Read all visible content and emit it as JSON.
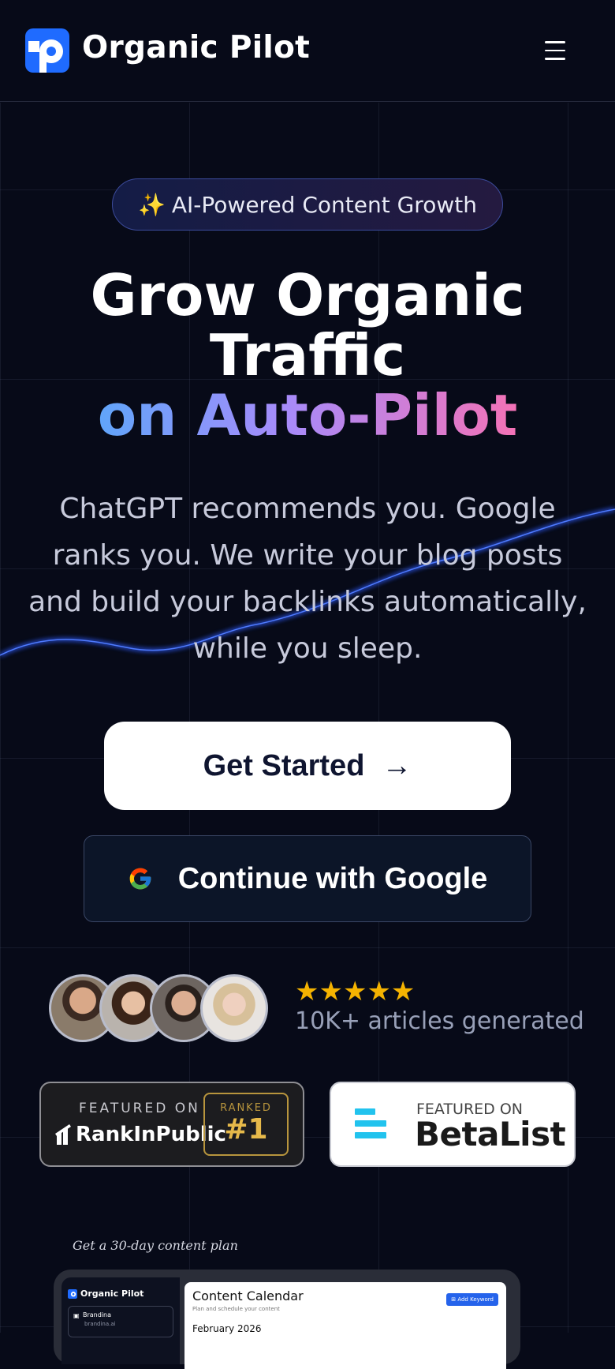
{
  "header": {
    "brand": "Organic Pilot",
    "logo_icon": "organic-pilot-logo",
    "menu_icon": "hamburger-menu-icon"
  },
  "hero": {
    "badge_emoji": "✨",
    "badge_text": "AI-Powered Content Growth",
    "title_line1": "Grow Organic",
    "title_line2": "Traffic",
    "title_line3": "on Auto-Pilot",
    "subtitle": "ChatGPT recommends you. Google ranks you. We write your blog posts and build your backlinks automatically, while you sleep."
  },
  "cta": {
    "primary_label": "Get Started",
    "primary_arrow": "→",
    "google_label": "Continue with Google"
  },
  "social_proof": {
    "avatars": [
      "avatar-1",
      "avatar-2",
      "avatar-3",
      "avatar-4"
    ],
    "stars": "★★★★★",
    "rating": 5,
    "articles_text": "10K+ articles generated"
  },
  "featured": {
    "rankinpublic": {
      "featured_label": "FEATURED ON",
      "name": "RankInPublic",
      "ranked_label": "RANKED",
      "rank": "#1"
    },
    "betalist": {
      "featured_label": "FEATURED ON",
      "name": "BetaList"
    }
  },
  "preview": {
    "note": "Get a 30-day content plan",
    "app_brand": "Organic Pilot",
    "workspace_name": "Brandina",
    "workspace_domain": "brandina.ai",
    "calendar_title": "Content Calendar",
    "calendar_subtitle": "Plan and schedule your content",
    "month": "February 2026",
    "add_keyword_label": "Add Keyword"
  },
  "colors": {
    "background": "#070a18",
    "accent_gradient": [
      "#60a5fa",
      "#a78bfa",
      "#f472b6"
    ],
    "star": "#f5b301",
    "betalist_blue": "#22c3ee",
    "rank_gold": "#e6b94a"
  }
}
